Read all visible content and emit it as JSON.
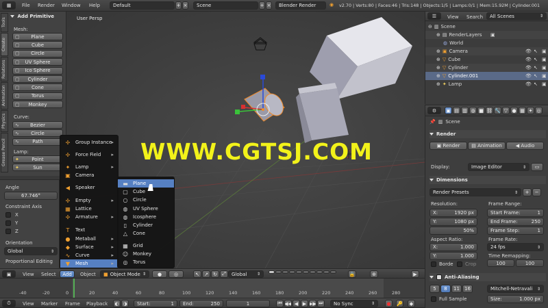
{
  "top_bar": {
    "menus": [
      "File",
      "Render",
      "Window",
      "Help"
    ],
    "screen_layout": "Default",
    "scene": "Scene",
    "render_engine": "Blender Render",
    "stats": "v2.70 | Verts:80 | Faces:46 | Tris:148 | Objects:1/5 | Lamps:0/1 | Mem:15.92M | Cylinder.001"
  },
  "tool_shelf": {
    "header": "Add Primitive",
    "mesh_label": "Mesh:",
    "mesh_items": [
      "Plane",
      "Cube",
      "Circle",
      "UV Sphere",
      "Ico Sphere",
      "Cylinder",
      "Cone",
      "Torus",
      "Monkey"
    ],
    "curve_label": "Curve:",
    "curve_items": [
      "Bezier",
      "Circle",
      "Path"
    ],
    "lamp_label": "Lamp:",
    "lamp_items": [
      "Point",
      "Sun"
    ],
    "tabs": [
      "Tools",
      "Create",
      "Relations",
      "Animation",
      "Physics",
      "Grease Pencil"
    ]
  },
  "operator_panel": {
    "angle_label": "Angle",
    "angle_value": "67.746°",
    "constraint_label": "Constraint Axis",
    "axes": [
      "X",
      "Y",
      "Z"
    ],
    "orientation_label": "Orientation",
    "orientation_value": "Global",
    "proportional_label": "Proportional Editing"
  },
  "viewport": {
    "label": "User Persp",
    "watermark": "WWW.CGTSJ.COM"
  },
  "add_menu": {
    "items": [
      {
        "label": "Group Instance",
        "icon": "✢",
        "sub": true
      },
      {
        "label": "Force Field",
        "icon": "✢",
        "sub": true
      },
      {
        "label": "Lamp",
        "icon": "✦",
        "sub": true
      },
      {
        "label": "Camera",
        "icon": "▣",
        "sub": false
      },
      {
        "label": "Speaker",
        "icon": "◀",
        "sub": false
      },
      {
        "label": "Empty",
        "icon": "✢",
        "sub": true
      },
      {
        "label": "Lattice",
        "icon": "▦",
        "sub": false
      },
      {
        "label": "Armature",
        "icon": "✢",
        "sub": true
      },
      {
        "label": "Text",
        "icon": "T",
        "sub": false
      },
      {
        "label": "Metaball",
        "icon": "●",
        "sub": true
      },
      {
        "label": "Surface",
        "icon": "◆",
        "sub": true
      },
      {
        "label": "Curve",
        "icon": "∿",
        "sub": true
      },
      {
        "label": "Mesh",
        "icon": "▼",
        "sub": true
      }
    ]
  },
  "mesh_submenu": {
    "items": [
      "Plane",
      "Cube",
      "Circle",
      "UV Sphere",
      "Icosphere",
      "Cylinder",
      "Cone",
      "Grid",
      "Monkey",
      "Torus"
    ]
  },
  "view3d_header": {
    "menus": [
      "View",
      "Select",
      "Add",
      "Object"
    ],
    "mode": "Object Mode",
    "orientation": "Global"
  },
  "timeline": {
    "ticks": [
      "-40",
      "-20",
      "0",
      "20",
      "40",
      "60",
      "80",
      "100",
      "120",
      "140",
      "160",
      "180",
      "200",
      "220",
      "240",
      "260",
      "280"
    ],
    "menus": [
      "View",
      "Marker",
      "Frame",
      "Playback"
    ],
    "start_label": "Start:",
    "start_value": "1",
    "end_label": "End:",
    "end_value": "250",
    "current": "1",
    "sync": "No Sync"
  },
  "outliner": {
    "menus": [
      "View",
      "Search"
    ],
    "filter": "All Scenes",
    "rows": [
      "Scene",
      "RenderLayers",
      "World",
      "Camera",
      "Cube",
      "Cylinder",
      "Cylinder.001",
      "Lamp"
    ]
  },
  "properties": {
    "scene_label": "Scene",
    "render_header": "Render",
    "render_buttons": [
      "Render",
      "Animation",
      "Audio"
    ],
    "display_label": "Display:",
    "display_value": "Image Editor",
    "dimensions_header": "Dimensions",
    "render_presets": "Render Presets",
    "resolution_label": "Resolution:",
    "res_x": "1920 px",
    "res_y": "1080 px",
    "res_pct": "50%",
    "frame_range_label": "Frame Range:",
    "start_frame": "Start Frame:",
    "start_frame_value": "1",
    "end_frame": "End Frame:",
    "end_frame_value": "250",
    "frame_step": "Frame Step:",
    "frame_step_value": "1",
    "aspect_label": "Aspect Ratio:",
    "aspect_x": "1.000",
    "aspect_y": "1.000",
    "frame_rate_label": "Frame Rate:",
    "frame_rate": "24 fps",
    "time_remap_label": "Time Remapping:",
    "remap_old": "100",
    "remap_new": "100",
    "border_label": "Borde",
    "crop_label": "Crop",
    "aa_header": "Anti-Aliasing",
    "aa_samples": [
      "5",
      "8",
      "11",
      "16"
    ],
    "aa_filter": "Mitchell-Netravali",
    "full_sample_label": "Full Sample",
    "size_label": "Size:",
    "size_value": "1.000 px"
  }
}
